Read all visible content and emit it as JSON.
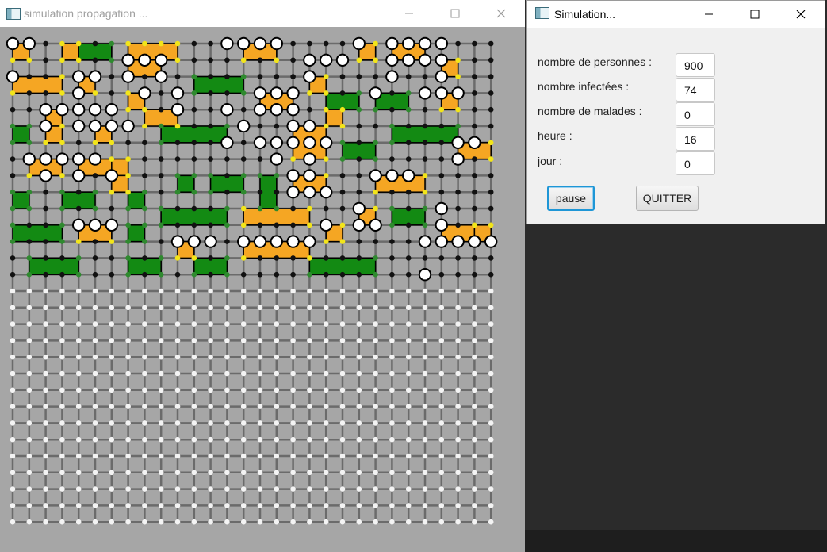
{
  "simulation_window": {
    "title": "simulation propagation ...",
    "controls": [
      "minimize-icon",
      "maximize-icon",
      "close-icon"
    ],
    "grid": {
      "cols": 30,
      "rows": 30,
      "active_rows": 15,
      "colors": {
        "background": "#a6a6a6",
        "line": "#6b6b6b",
        "empty_node": "#f4f4f4",
        "node": "#111111",
        "infected_node": "#f2e51a",
        "green_node": "#2f8a2f",
        "person_fill": "#ffffff",
        "infected_zone": "#f5a623",
        "safe_zone": "#138a13"
      },
      "infected_zones": [
        [
          0,
          0,
          1,
          1
        ],
        [
          0,
          2,
          3,
          3
        ],
        [
          2,
          4,
          3,
          5
        ],
        [
          3,
          0,
          4,
          1
        ],
        [
          4,
          2,
          5,
          3
        ],
        [
          5,
          5,
          6,
          6
        ],
        [
          6,
          7,
          7,
          8
        ],
        [
          7,
          3,
          8,
          4
        ],
        [
          8,
          0,
          9,
          1
        ],
        [
          8,
          4,
          10,
          5
        ],
        [
          15,
          3,
          17,
          4
        ],
        [
          14,
          0,
          16,
          1
        ],
        [
          17,
          5,
          19,
          7
        ],
        [
          18,
          2,
          19,
          3
        ],
        [
          19,
          4,
          20,
          5
        ],
        [
          21,
          0,
          22,
          1
        ],
        [
          23,
          0,
          25,
          1
        ],
        [
          26,
          1,
          27,
          2
        ],
        [
          26,
          3,
          27,
          4
        ],
        [
          27,
          6,
          29,
          7
        ],
        [
          22,
          8,
          25,
          9
        ],
        [
          26,
          11,
          28,
          12
        ],
        [
          28,
          11,
          29,
          12
        ],
        [
          14,
          10,
          18,
          11
        ],
        [
          14,
          12,
          18,
          13
        ],
        [
          17,
          8,
          19,
          9
        ],
        [
          19,
          11,
          20,
          12
        ],
        [
          21,
          10,
          22,
          11
        ],
        [
          10,
          12,
          11,
          13
        ],
        [
          1,
          7,
          3,
          8
        ],
        [
          4,
          7,
          6,
          8
        ],
        [
          6,
          8,
          7,
          9
        ],
        [
          4,
          11,
          6,
          12
        ],
        [
          7,
          0,
          10,
          1
        ],
        [
          7,
          1,
          9,
          2
        ],
        [
          2,
          5,
          3,
          6
        ]
      ],
      "safe_zones": [
        [
          4,
          0,
          6,
          1
        ],
        [
          11,
          2,
          14,
          3
        ],
        [
          9,
          5,
          13,
          6
        ],
        [
          0,
          5,
          1,
          6
        ],
        [
          10,
          8,
          11,
          9
        ],
        [
          12,
          8,
          14,
          9
        ],
        [
          15,
          8,
          16,
          10
        ],
        [
          19,
          3,
          21,
          4
        ],
        [
          22,
          3,
          24,
          4
        ],
        [
          20,
          6,
          22,
          7
        ],
        [
          23,
          5,
          27,
          6
        ],
        [
          23,
          10,
          25,
          11
        ],
        [
          9,
          10,
          13,
          11
        ],
        [
          0,
          11,
          3,
          12
        ],
        [
          7,
          9,
          8,
          10
        ],
        [
          7,
          11,
          8,
          12
        ],
        [
          1,
          13,
          4,
          14
        ],
        [
          7,
          13,
          9,
          14
        ],
        [
          11,
          13,
          13,
          14
        ],
        [
          18,
          13,
          22,
          14
        ],
        [
          3,
          9,
          5,
          10
        ],
        [
          0,
          9,
          1,
          10
        ]
      ],
      "persons": [
        [
          0,
          0
        ],
        [
          1,
          0
        ],
        [
          13,
          0
        ],
        [
          14,
          0
        ],
        [
          15,
          0
        ],
        [
          16,
          0
        ],
        [
          21,
          0
        ],
        [
          23,
          0
        ],
        [
          24,
          0
        ],
        [
          25,
          0
        ],
        [
          26,
          0
        ],
        [
          7,
          1
        ],
        [
          8,
          1
        ],
        [
          9,
          1
        ],
        [
          18,
          1
        ],
        [
          19,
          1
        ],
        [
          20,
          1
        ],
        [
          23,
          1
        ],
        [
          24,
          1
        ],
        [
          25,
          1
        ],
        [
          26,
          1
        ],
        [
          0,
          2
        ],
        [
          4,
          2
        ],
        [
          5,
          2
        ],
        [
          7,
          2
        ],
        [
          9,
          2
        ],
        [
          18,
          2
        ],
        [
          23,
          2
        ],
        [
          26,
          2
        ],
        [
          4,
          3
        ],
        [
          8,
          3
        ],
        [
          10,
          3
        ],
        [
          15,
          3
        ],
        [
          16,
          3
        ],
        [
          17,
          3
        ],
        [
          22,
          3
        ],
        [
          25,
          3
        ],
        [
          26,
          3
        ],
        [
          27,
          3
        ],
        [
          2,
          4
        ],
        [
          3,
          4
        ],
        [
          4,
          4
        ],
        [
          5,
          4
        ],
        [
          6,
          4
        ],
        [
          10,
          4
        ],
        [
          13,
          4
        ],
        [
          15,
          4
        ],
        [
          16,
          4
        ],
        [
          17,
          4
        ],
        [
          2,
          5
        ],
        [
          4,
          5
        ],
        [
          5,
          5
        ],
        [
          6,
          5
        ],
        [
          7,
          5
        ],
        [
          14,
          5
        ],
        [
          17,
          5
        ],
        [
          18,
          5
        ],
        [
          13,
          6
        ],
        [
          15,
          6
        ],
        [
          16,
          6
        ],
        [
          17,
          6
        ],
        [
          18,
          6
        ],
        [
          19,
          6
        ],
        [
          27,
          6
        ],
        [
          28,
          6
        ],
        [
          1,
          7
        ],
        [
          2,
          7
        ],
        [
          3,
          7
        ],
        [
          4,
          7
        ],
        [
          5,
          7
        ],
        [
          16,
          7
        ],
        [
          18,
          7
        ],
        [
          27,
          7
        ],
        [
          2,
          8
        ],
        [
          4,
          8
        ],
        [
          6,
          8
        ],
        [
          17,
          8
        ],
        [
          18,
          8
        ],
        [
          22,
          8
        ],
        [
          23,
          8
        ],
        [
          24,
          8
        ],
        [
          17,
          9
        ],
        [
          18,
          9
        ],
        [
          19,
          9
        ],
        [
          26,
          10
        ],
        [
          21,
          10
        ],
        [
          4,
          11
        ],
        [
          5,
          11
        ],
        [
          6,
          11
        ],
        [
          19,
          11
        ],
        [
          21,
          11
        ],
        [
          22,
          11
        ],
        [
          26,
          11
        ],
        [
          10,
          12
        ],
        [
          11,
          12
        ],
        [
          12,
          12
        ],
        [
          14,
          12
        ],
        [
          15,
          12
        ],
        [
          16,
          12
        ],
        [
          17,
          12
        ],
        [
          18,
          12
        ],
        [
          25,
          12
        ],
        [
          26,
          12
        ],
        [
          27,
          12
        ],
        [
          28,
          12
        ],
        [
          29,
          12
        ],
        [
          25,
          14
        ]
      ]
    }
  },
  "control_window": {
    "title": "Simulation...",
    "fields": [
      {
        "label": "nombre de personnes :",
        "value": "900"
      },
      {
        "label": "nombre infectées :",
        "value": "74"
      },
      {
        "label": "nombre de malades :",
        "value": "0"
      },
      {
        "label": "heure :",
        "value": "16"
      },
      {
        "label": "jour :",
        "value": "0"
      }
    ],
    "pause_label": "pause",
    "quit_label": "QUITTER"
  }
}
